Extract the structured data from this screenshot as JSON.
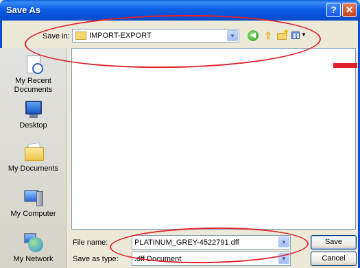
{
  "window": {
    "title": "Save As",
    "help_label": "?",
    "close_label": "✕"
  },
  "toolbar": {
    "save_in_label": "Save in:",
    "save_in_value": "IMPORT-EXPORT",
    "icons": [
      "folder-icon",
      "back-icon",
      "up-folder-icon",
      "new-folder-icon",
      "views-menu-icon"
    ]
  },
  "places": [
    {
      "label": "My Recent Documents",
      "icon": "recent-documents-icon"
    },
    {
      "label": "Desktop",
      "icon": "desktop-icon"
    },
    {
      "label": "My Documents",
      "icon": "my-documents-icon"
    },
    {
      "label": "My Computer",
      "icon": "my-computer-icon"
    },
    {
      "label": "My Network",
      "icon": "my-network-icon"
    }
  ],
  "form": {
    "file_name_label": "File name:",
    "file_name_value": "PLATINUM_GREY-4522791.dff",
    "save_as_type_label": "Save as type:",
    "save_as_type_value": ".dff Document"
  },
  "buttons": {
    "save": "Save",
    "cancel": "Cancel"
  },
  "colors": {
    "title_bar": "#0b5ee4",
    "dialog_bg": "#ece9d8",
    "annotation": "#e2212a"
  }
}
